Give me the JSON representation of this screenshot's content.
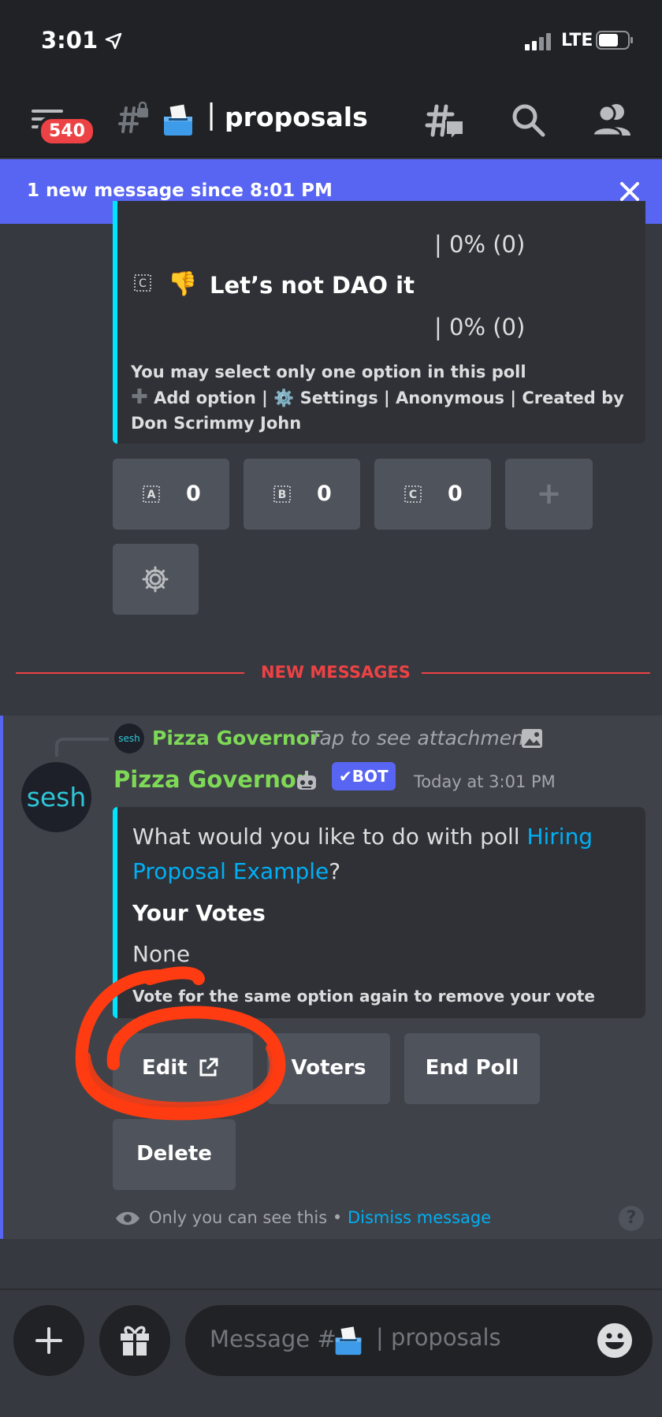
{
  "status_bar": {
    "time": "3:01",
    "network": "LTE"
  },
  "header": {
    "badge_count": "540",
    "channel_separator": "|",
    "channel_name": "proposals",
    "icons": [
      "hamburger-icon",
      "hash-lock-icon",
      "ballot-box-icon",
      "threads-icon",
      "search-icon",
      "members-icon"
    ]
  },
  "new_message_bar": {
    "text": "1 new message since 8:01 PM",
    "close": "✕"
  },
  "poll": {
    "option_b_result": "| 0% (0)",
    "option_c_letter": "C",
    "option_c_emoji": "👎",
    "option_c_label": "Let’s not DAO it",
    "option_c_result": "| 0% (0)",
    "note_line1": "You may select only one option in this poll",
    "note_line2": "Add option | ",
    "note_line2b": "Settings | Anonymous | Created by",
    "note_line3": "Don Scrimmy John",
    "vote_buttons": [
      {
        "letter": "A",
        "count": "0"
      },
      {
        "letter": "B",
        "count": "0"
      },
      {
        "letter": "C",
        "count": "0"
      }
    ],
    "add_button": "+",
    "settings_button_icon": "gear-icon"
  },
  "divider": {
    "text": "NEW MESSAGES"
  },
  "message": {
    "reply_avatar_text": "sesh",
    "reply_author": "Pizza Governor",
    "reply_text": "Tap to see attachment",
    "avatar_text": "sesh",
    "author": "Pizza Governor",
    "bot_tag": "✔BOT",
    "timestamp": "Today at 3:01 PM",
    "embed": {
      "question_prefix": "What would you like to do with poll ",
      "question_link": "Hiring Proposal Example",
      "question_suffix": "?",
      "votes_title": "Your Votes",
      "votes_value": "None",
      "hint": "Vote for the same option again to remove your vote"
    },
    "buttons": {
      "edit": "Edit",
      "voters": "Voters",
      "end_poll": "End Poll",
      "delete": "Delete"
    },
    "footer_text": "Only you can see this • ",
    "footer_link": "Dismiss message",
    "help": "?"
  },
  "composer": {
    "placeholder_prefix": "Message #",
    "placeholder_separator": "|",
    "placeholder_channel": "proposals"
  },
  "colors": {
    "accent": "#5865f2",
    "embed_bar": "#00e3ff",
    "bot_name": "#7ed957",
    "danger": "#ed4245",
    "link": "#00aff4",
    "annotation": "#ff3b12"
  }
}
